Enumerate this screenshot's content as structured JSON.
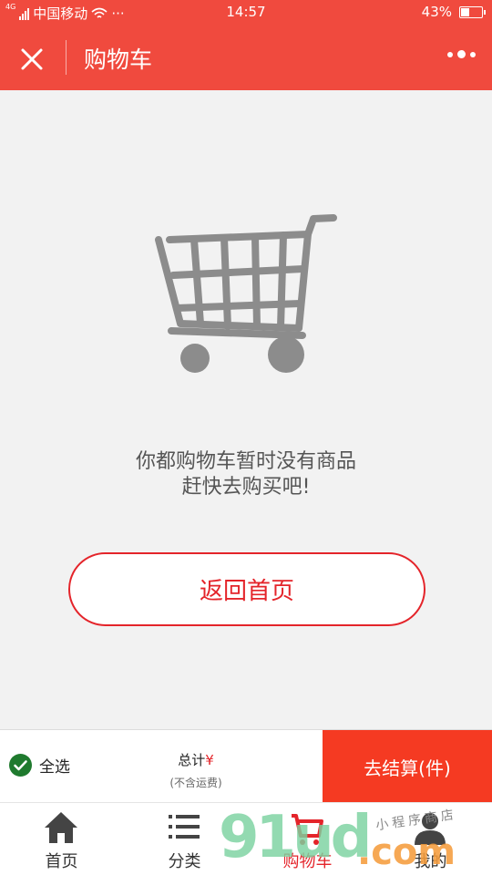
{
  "status_bar": {
    "network": "4G",
    "carrier": "中国移动",
    "more": "···",
    "time": "14:57",
    "battery": "43%",
    "battery_level": 0.43
  },
  "nav": {
    "title": "购物车"
  },
  "empty_state": {
    "line1": "你都购物车暂时没有商品",
    "line2": "赶快去购买吧!",
    "button": "返回首页"
  },
  "checkout": {
    "select_all": "全选",
    "total_label": "总计",
    "currency": "¥",
    "shipping_note": "(不含运费)",
    "checkout_button": "去结算(件)"
  },
  "tabs": [
    {
      "label": "首页",
      "icon": "home-icon"
    },
    {
      "label": "分类",
      "icon": "list-icon"
    },
    {
      "label": "购物车",
      "icon": "cart-icon",
      "active": true
    },
    {
      "label": "我的",
      "icon": "user-icon"
    }
  ],
  "watermark": {
    "digits": "91ud",
    "domain": ".com",
    "cursive": "小程序商店"
  },
  "colors": {
    "brand": "#f04a3e",
    "accent": "#e4242a",
    "checkout": "#f53a22",
    "check": "#1f7a2e"
  }
}
